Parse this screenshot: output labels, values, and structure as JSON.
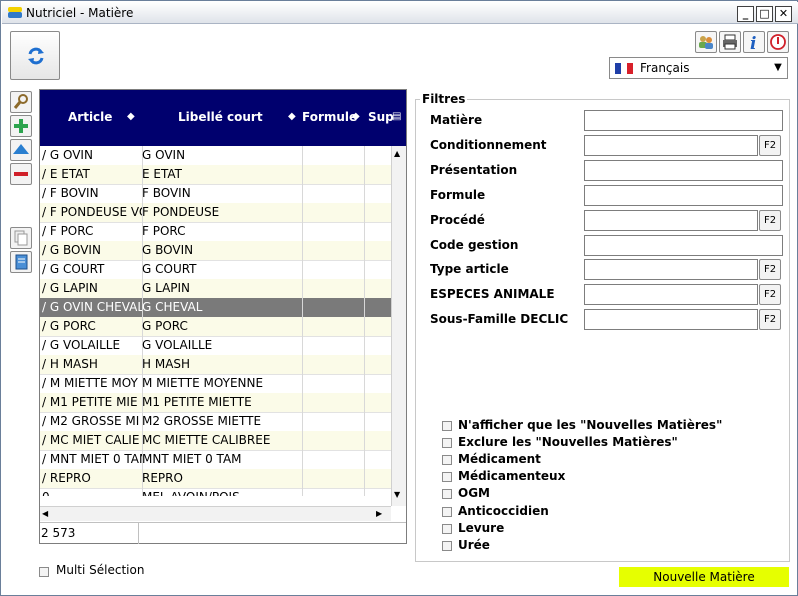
{
  "window": {
    "title": "Nutriciel - Matière",
    "min_label": "_",
    "max_label": "□",
    "close_label": "✕"
  },
  "colors": {
    "header_bg": "#00006e",
    "selected_row": "#7a7a7a",
    "alt_row": "#fbfbe8",
    "new_button": "#e6ff00"
  },
  "toolbar": {
    "refresh_icon": "refresh-icon",
    "tools": [
      "users-icon",
      "print-icon",
      "info-icon",
      "power-icon"
    ]
  },
  "language": {
    "selected": "Français",
    "flag": [
      "#1f3fa8",
      "#ffffff",
      "#d8202a"
    ]
  },
  "left_toolbar": [
    "search-icon",
    "add-icon",
    "up-icon",
    "remove-icon",
    "copy-icon",
    "document-icon"
  ],
  "grid": {
    "columns": [
      "Article",
      "Libellé court",
      "Formule",
      "Sup"
    ],
    "rows": [
      [
        "/ G OVIN",
        "G OVIN",
        "",
        ""
      ],
      [
        "/ E ETAT",
        "E ETAT",
        "",
        ""
      ],
      [
        "/ F BOVIN",
        "F BOVIN",
        "",
        ""
      ],
      [
        "/ F PONDEUSE VO",
        "F PONDEUSE",
        "",
        ""
      ],
      [
        "/ F PORC",
        "F PORC",
        "",
        ""
      ],
      [
        "/ G BOVIN",
        "G BOVIN",
        "",
        ""
      ],
      [
        "/ G COURT",
        "G COURT",
        "",
        ""
      ],
      [
        "/ G LAPIN",
        "G LAPIN",
        "",
        ""
      ],
      [
        "/ G OVIN CHEVAL",
        "G CHEVAL",
        "",
        ""
      ],
      [
        "/ G PORC",
        "G PORC",
        "",
        ""
      ],
      [
        "/ G VOLAILLE",
        "G VOLAILLE",
        "",
        ""
      ],
      [
        "/ H MASH",
        "H MASH",
        "",
        ""
      ],
      [
        "/ M MIETTE MOY",
        "M MIETTE MOYENNE",
        "",
        ""
      ],
      [
        "/ M1 PETITE MIE",
        "M1 PETITE MIETTE",
        "",
        ""
      ],
      [
        "/ M2 GROSSE MI",
        "M2 GROSSE MIETTE",
        "",
        ""
      ],
      [
        "/ MC MIET CALIE",
        "MC MIETTE CALIBREE",
        "",
        ""
      ],
      [
        "/ MNT MIET 0 TAM",
        "MNT MIET 0 TAM",
        "",
        ""
      ],
      [
        "/ REPRO",
        "REPRO",
        "",
        ""
      ],
      [
        "0",
        "MEL AVOIN/POIS",
        "",
        ""
      ]
    ],
    "selected_index": 8,
    "count": "2 573"
  },
  "filters": {
    "legend": "Filtres",
    "fields": [
      {
        "label": "Matière",
        "value": "",
        "f2": false
      },
      {
        "label": "Conditionnement",
        "value": "",
        "f2": true
      },
      {
        "label": "Présentation",
        "value": "",
        "f2": false
      },
      {
        "label": "Formule",
        "value": "",
        "f2": false
      },
      {
        "label": "Procédé",
        "value": "",
        "f2": true
      },
      {
        "label": "Code gestion",
        "value": "",
        "f2": false
      },
      {
        "label": "Type article",
        "value": "",
        "f2": true
      },
      {
        "label": "ESPECES ANIMALE",
        "value": "",
        "f2": true
      },
      {
        "label": "Sous-Famille DECLIC",
        "value": "",
        "f2": true
      }
    ],
    "f2_label": "F2",
    "checkboxes": [
      "N'afficher que les \"Nouvelles Matières\"",
      "Exclure les \"Nouvelles Matières\"",
      "Médicament",
      "Médicamenteux",
      "OGM",
      "Anticoccidien",
      "Levure",
      "Urée"
    ]
  },
  "multi_selection": {
    "label": "Multi Sélection",
    "checked": false
  },
  "new_button": {
    "label": "Nouvelle Matière"
  }
}
